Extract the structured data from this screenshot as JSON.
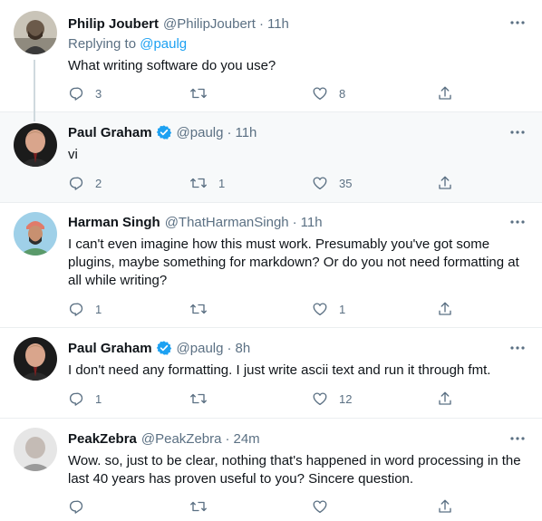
{
  "tweets": [
    {
      "name": "Philip Joubert",
      "handle": "@PhilipJoubert",
      "dot": "·",
      "time": "11h",
      "replying_prefix": "Replying to ",
      "replying_handle": "@paulg",
      "text": "What writing software do you use?",
      "replies": "3",
      "retweets": "",
      "likes": "8"
    },
    {
      "name": "Paul Graham",
      "verified": true,
      "handle": "@paulg",
      "dot": "·",
      "time": "11h",
      "text": "vi",
      "replies": "2",
      "retweets": "1",
      "likes": "35"
    },
    {
      "name": "Harman Singh",
      "handle": "@ThatHarmanSingh",
      "dot": "·",
      "time": "11h",
      "text": "I can't even imagine how this must work. Presumably you've got some plugins, maybe something for markdown? Or do you not need formatting at all while writing?",
      "replies": "1",
      "retweets": "",
      "likes": "1"
    },
    {
      "name": "Paul Graham",
      "verified": true,
      "handle": "@paulg",
      "dot": "·",
      "time": "8h",
      "text": "I don't need any formatting. I just write ascii text and run it through fmt.",
      "replies": "1",
      "retweets": "",
      "likes": "12"
    },
    {
      "name": "PeakZebra",
      "handle": "@PeakZebra",
      "dot": "·",
      "time": "24m",
      "text": "Wow. so, just to be clear, nothing that's happened in word processing in the last 40 years has proven useful to you? Sincere question.",
      "replies": "",
      "retweets": "",
      "likes": ""
    }
  ],
  "icons": {
    "reply": "reply-icon",
    "retweet": "retweet-icon",
    "like": "heart-icon",
    "share": "share-icon",
    "more": "more-icon",
    "verified": "verified-badge-icon"
  },
  "colors": {
    "text": "#0f1419",
    "secondary": "#5b7083",
    "link": "#1da1f2",
    "verified": "#1da1f2",
    "highlight_bg": "#f7f9fa",
    "divider": "#ebeef0"
  }
}
